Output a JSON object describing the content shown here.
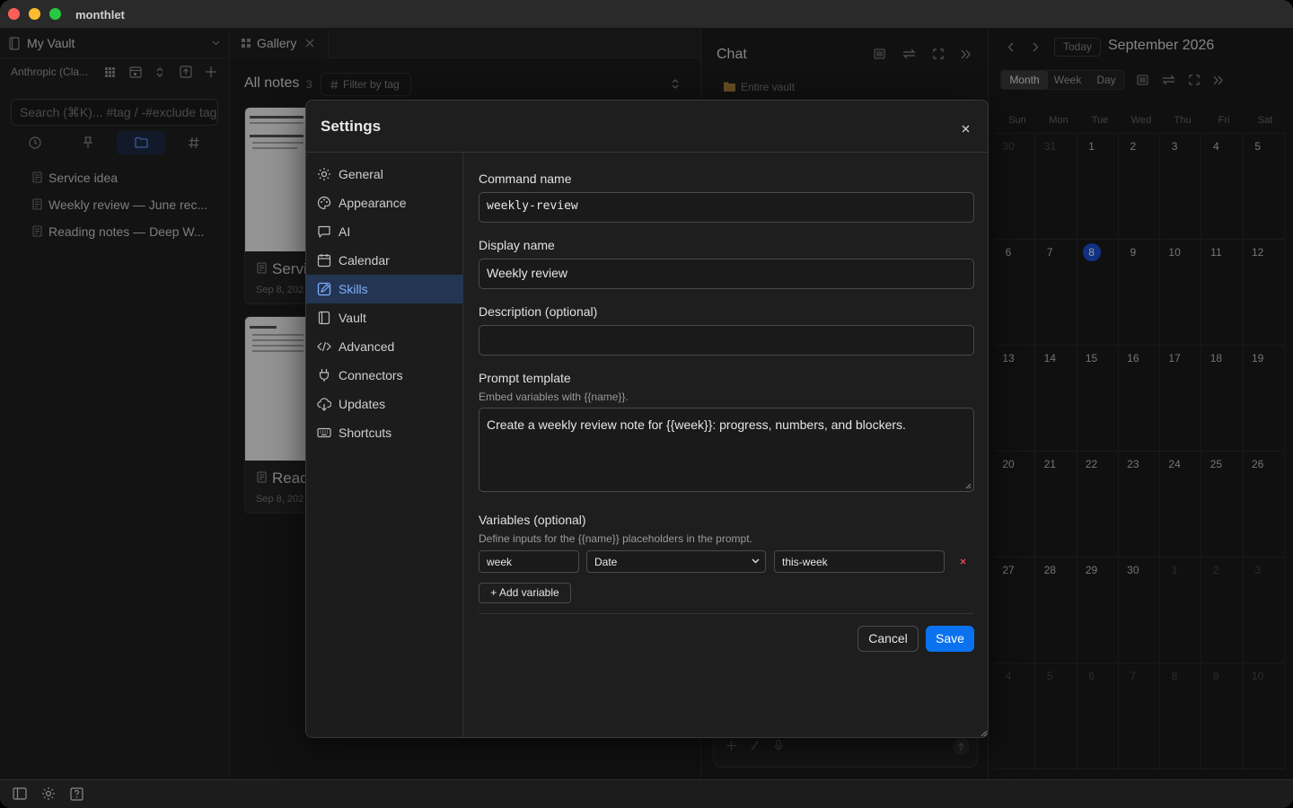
{
  "app": {
    "title": "monthlet"
  },
  "sidebar": {
    "vault_name": "My Vault",
    "provider": "Anthropic (Cla...",
    "search_placeholder": "Search (⌘K)... #tag / -#exclude tag",
    "notes": [
      {
        "label": "Service idea"
      },
      {
        "label": "Weekly review — June rec..."
      },
      {
        "label": "Reading notes — Deep W..."
      }
    ]
  },
  "gallery": {
    "tab_label": "Gallery",
    "heading": "All notes",
    "count": "3",
    "filter_label": "Filter by tag",
    "cards": [
      {
        "title": "Servi",
        "date": "Sep 8, 202"
      },
      {
        "title": "Read",
        "date": "Sep 8, 202"
      }
    ]
  },
  "chat": {
    "title": "Chat",
    "scope": "Entire vault"
  },
  "calendar": {
    "today_label": "Today",
    "title": "September 2026",
    "views": [
      "Month",
      "Week",
      "Day"
    ],
    "active_view": "Month",
    "weekdays": [
      "Sun",
      "Mon",
      "Tue",
      "Wed",
      "Thu",
      "Fri",
      "Sat"
    ],
    "weeks": [
      [
        "30",
        "31",
        "1",
        "2",
        "3",
        "4",
        "5"
      ],
      [
        "6",
        "7",
        "8",
        "9",
        "10",
        "11",
        "12"
      ],
      [
        "13",
        "14",
        "15",
        "16",
        "17",
        "18",
        "19"
      ],
      [
        "20",
        "21",
        "22",
        "23",
        "24",
        "25",
        "26"
      ],
      [
        "27",
        "28",
        "29",
        "30",
        "1",
        "2",
        "3"
      ],
      [
        "4",
        "5",
        "6",
        "7",
        "8",
        "9",
        "10"
      ]
    ],
    "today": "8"
  },
  "settings": {
    "title": "Settings",
    "nav": [
      {
        "label": "General",
        "icon": "gear-icon"
      },
      {
        "label": "Appearance",
        "icon": "palette-icon"
      },
      {
        "label": "AI",
        "icon": "chat-bubble-icon"
      },
      {
        "label": "Calendar",
        "icon": "calendar-icon"
      },
      {
        "label": "Skills",
        "icon": "edit-square-icon"
      },
      {
        "label": "Vault",
        "icon": "book-icon"
      },
      {
        "label": "Advanced",
        "icon": "code-icon"
      },
      {
        "label": "Connectors",
        "icon": "plug-icon"
      },
      {
        "label": "Updates",
        "icon": "download-cloud-icon"
      },
      {
        "label": "Shortcuts",
        "icon": "keyboard-icon"
      }
    ],
    "active_nav": "Skills",
    "form": {
      "command_name_label": "Command name",
      "command_name_value": "weekly-review",
      "display_name_label": "Display name",
      "display_name_value": "Weekly review",
      "description_label": "Description (optional)",
      "description_value": "",
      "prompt_label": "Prompt template",
      "prompt_hint": "Embed variables with {{name}}.",
      "prompt_value": "Create a weekly review note for {{week}}: progress, numbers, and blockers.",
      "variables_label": "Variables (optional)",
      "variables_hint": "Define inputs for the {{name}} placeholders in the prompt.",
      "variables": [
        {
          "name": "week",
          "type": "Date",
          "default": "this-week"
        }
      ],
      "add_variable_label": "+ Add variable",
      "cancel_label": "Cancel",
      "save_label": "Save"
    }
  },
  "colors": {
    "accent": "#0a72ef",
    "today": "#1d4fd6",
    "active_nav_bg": "#233553"
  }
}
